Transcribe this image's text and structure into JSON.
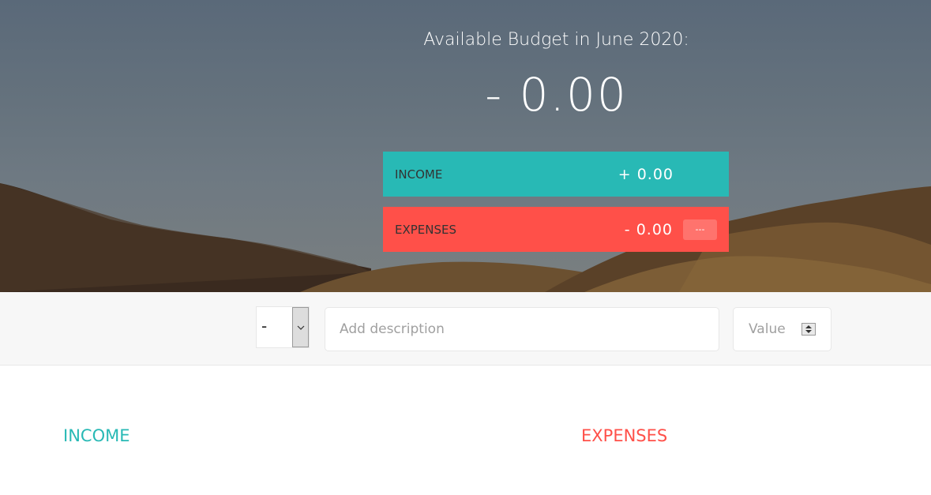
{
  "budget": {
    "title": "Available Budget in June 2020:",
    "value": "- 0.00"
  },
  "summary": {
    "income": {
      "label": "INCOME",
      "value": "+ 0.00",
      "color": "#28b9b5"
    },
    "expenses": {
      "label": "EXPENSES",
      "value": "- 0.00",
      "percentage": "---",
      "color": "#ff5049"
    }
  },
  "add": {
    "type_value": "-",
    "description_placeholder": "Add description",
    "value_placeholder": "Value",
    "chevron_icon": "chevron-down-icon",
    "spinner_icon": "spinner-arrows-icon"
  },
  "lists": {
    "income_title": "INCOME",
    "expenses_title": "EXPENSES"
  }
}
